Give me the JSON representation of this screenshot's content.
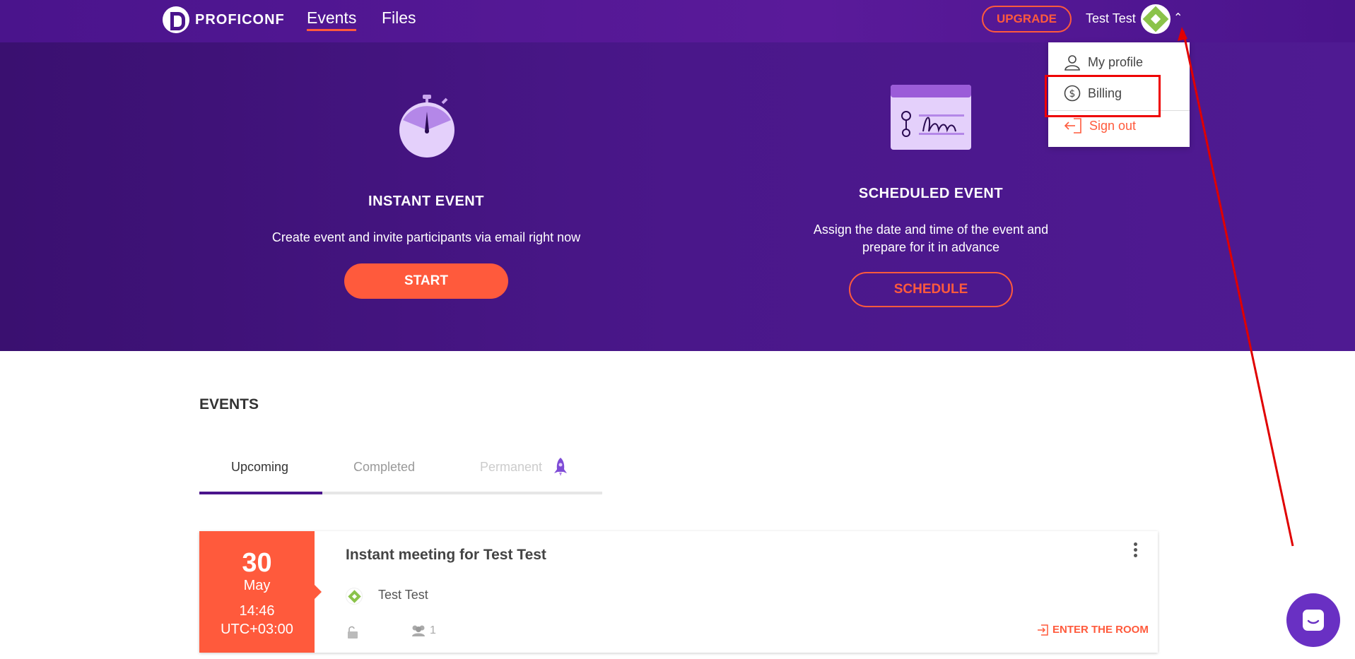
{
  "topbar": {
    "logo_text": "PROFICONF",
    "nav": {
      "events": "Events",
      "files": "Files"
    },
    "upgrade_label": "UPGRADE",
    "user_name": "Test Test"
  },
  "hero": {
    "instant": {
      "title": "INSTANT EVENT",
      "desc": "Create event and invite participants via email right now",
      "button": "START"
    },
    "scheduled": {
      "title": "SCHEDULED EVENT",
      "desc_line1": "Assign the date and time of the event and",
      "desc_line2": "prepare for it in advance",
      "button": "SCHEDULE"
    }
  },
  "dropdown": {
    "items": [
      {
        "label": "My profile",
        "icon": "user-icon"
      },
      {
        "label": "Billing",
        "icon": "dollar-icon"
      },
      {
        "label": "Sign out",
        "icon": "sign-out-icon"
      }
    ]
  },
  "events": {
    "heading": "EVENTS",
    "tabs": [
      {
        "label": "Upcoming",
        "state": "active"
      },
      {
        "label": "Completed",
        "state": "inactive"
      },
      {
        "label": "Permanent",
        "state": "disabled"
      }
    ],
    "cards": [
      {
        "day": "30",
        "month": "May",
        "time": "14:46",
        "timezone": "UTC+03:00",
        "title": "Instant meeting for Test Test",
        "host": "Test Test",
        "participants": "1",
        "enter_label": "ENTER THE ROOM"
      }
    ]
  },
  "colors": {
    "brand_purple": "#4a148c",
    "accent_orange": "#ff5a3c",
    "chat_purple": "#6930c3",
    "annotation_red": "#e00000"
  }
}
